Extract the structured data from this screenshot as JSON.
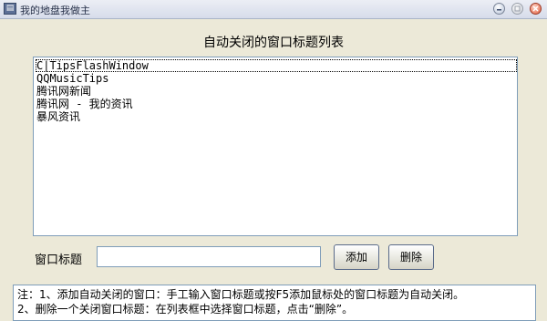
{
  "window": {
    "title": "我的地盘我做主",
    "icon_name": "app-window-icon"
  },
  "heading": "自动关闭的窗口标题列表",
  "list": {
    "items": [
      "C|TipsFlashWindow",
      "QQMusicTips",
      "腾讯网新闻",
      "腾讯网 - 我的资讯",
      "暴风资讯"
    ],
    "focused_index": 0
  },
  "form": {
    "label": "窗口标题",
    "input_value": "",
    "add_label": "添加",
    "delete_label": "删除"
  },
  "notes": [
    "注：1、添加自动关闭的窗口：手工输入窗口标题或按F5添加鼠标处的窗口标题为自动关闭。",
    "2、删除一个关闭窗口标题：在列表框中选择窗口标题，点击“删除”。"
  ],
  "colors": {
    "dialog_bg": "#ece9d8",
    "border": "#7f9db9",
    "close_button": "#e15b3b"
  }
}
